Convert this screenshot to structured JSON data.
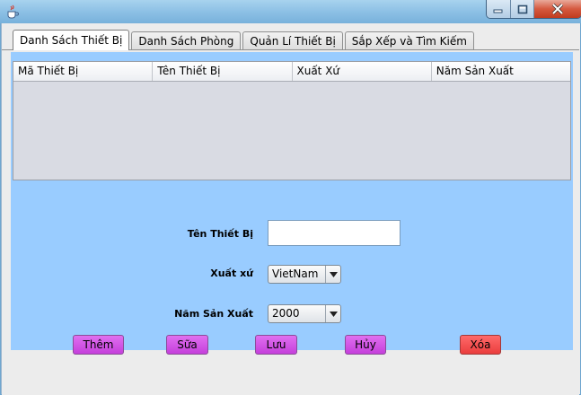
{
  "tabs": [
    {
      "label": "Danh Sách Thiết Bị",
      "active": true
    },
    {
      "label": "Danh Sách Phòng",
      "active": false
    },
    {
      "label": "Quản Lí Thiết Bị",
      "active": false
    },
    {
      "label": "Sắp Xếp và Tìm Kiếm",
      "active": false
    }
  ],
  "table": {
    "columns": [
      "Mã Thiết Bị",
      "Tên Thiết Bị",
      "Xuất Xứ",
      "Năm Sản Xuất"
    ],
    "rows": []
  },
  "form": {
    "name_label": "Tên Thiết Bị",
    "name_value": "",
    "origin_label": "Xuất xứ",
    "origin_value": "VietNam",
    "year_label": "Năm Sản Xuất",
    "year_value": "2000"
  },
  "buttons": {
    "add": "Thêm",
    "edit": "Sữa",
    "save": "Lưu",
    "cancel": "Hủy",
    "delete": "Xóa"
  },
  "colors": {
    "form_background": "#99ccff",
    "action_button": "#d14ce6",
    "delete_button": "#f04848",
    "title_bar": "#8fc2e6"
  },
  "icons": {
    "app": "java-cup-icon",
    "minimize": "minimize-icon",
    "maximize": "maximize-icon",
    "close": "close-icon"
  }
}
